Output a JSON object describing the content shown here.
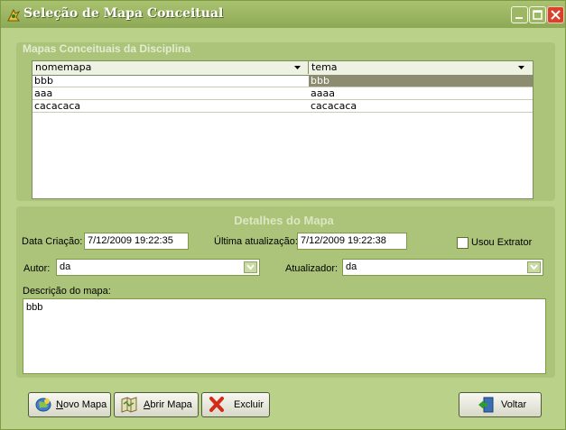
{
  "window": {
    "title": "Seleção de Mapa Conceitual"
  },
  "maps_group": {
    "title": "Mapas Conceituais da Disciplina",
    "columns": [
      "nomemapa",
      "tema"
    ],
    "rows": [
      [
        "bbb",
        "bbb"
      ],
      [
        "aaa",
        "aaaa"
      ],
      [
        "cacacaca",
        "cacacaca"
      ]
    ]
  },
  "details": {
    "title": "Detalhes do Mapa",
    "created_label": "Data Criação:",
    "created_value": "7/12/2009 19:22:35",
    "updated_label": "Última atualização:",
    "updated_value": "7/12/2009 19:22:38",
    "extractor_label": "Usou Extrator",
    "author_label": "Autor:",
    "author_value": "da",
    "updater_label": "Atualizador:",
    "updater_value": "da",
    "description_label": "Descrição do mapa:",
    "description_value": "bbb"
  },
  "buttons": {
    "new_first": "N",
    "new_rest": "ovo Mapa",
    "open_first": "A",
    "open_rest": "brir Mapa",
    "delete": "Excluir",
    "back": "Voltar"
  },
  "colors": {
    "window_bg": "#b9d189",
    "group_bg": "#abc47a",
    "selection": "#8c8c70",
    "close": "#d9412a"
  }
}
